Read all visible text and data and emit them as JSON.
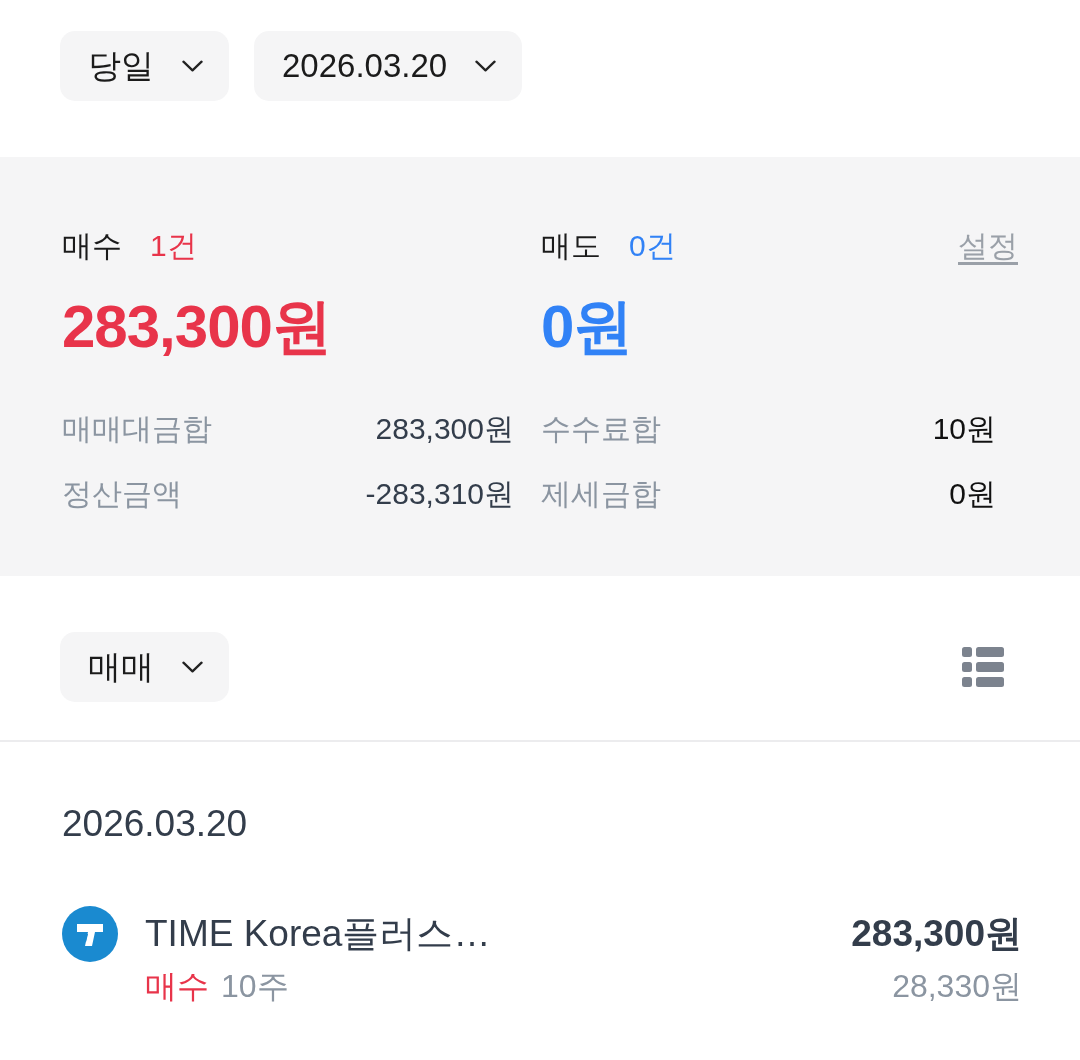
{
  "filters": [
    {
      "label": "당일"
    },
    {
      "label": "2026.03.20"
    }
  ],
  "summary": {
    "sides": [
      {
        "kind": "buy",
        "label": "매수",
        "count": "1건",
        "amount": "283,300원"
      },
      {
        "kind": "sell",
        "label": "매도",
        "count": "0건",
        "amount": "0원"
      }
    ],
    "settings_link": "설정",
    "details": [
      {
        "label": "매매대금합",
        "value": "283,300원"
      },
      {
        "label": "수수료합",
        "value": "10원"
      },
      {
        "label": "정산금액",
        "value": "-283,310원"
      },
      {
        "label": "제세금합",
        "value": "0원"
      }
    ]
  },
  "list_filter": {
    "label": "매매"
  },
  "groups": [
    {
      "date": "2026.03.20",
      "trades": [
        {
          "name": "TIME Korea플러스…",
          "kind": "buy",
          "side": "매수",
          "quantity": "10주",
          "total": "283,300원",
          "price": "28,330원"
        }
      ]
    }
  ]
}
